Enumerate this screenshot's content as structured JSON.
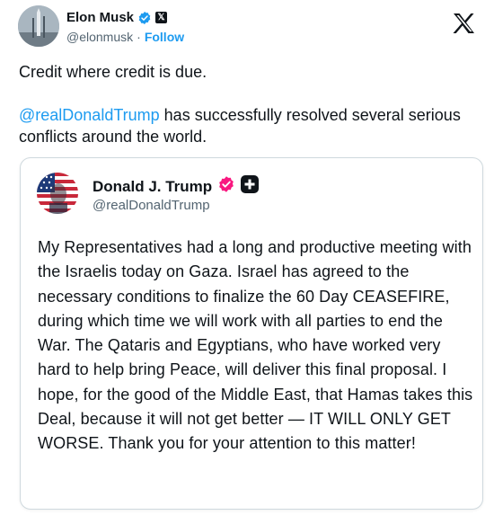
{
  "author": {
    "name": "Elon Musk",
    "handle": "@elonmusk",
    "separator": "·",
    "follow_label": "Follow",
    "verified_color": "#1d9bf0"
  },
  "platform_icon": "x-logo-icon",
  "tweet": {
    "line1": "Credit where credit is due.",
    "mention": "@realDonaldTrump",
    "line2_rest": " has successfully resolved several serious conflicts around the world."
  },
  "quoted": {
    "name": "Donald J. Trump",
    "handle": "@realDonaldTrump",
    "badge_color": "#f91880",
    "text": "My Representatives had a long and productive meeting with the Israelis today on Gaza. Israel has agreed to the necessary conditions to finalize the 60 Day CEASEFIRE, during which time we will work with all parties to end the War. The Qataris and Egyptians, who have worked very hard to help bring Peace, will deliver this final proposal. I hope, for the good of the Middle East, that Hamas takes this Deal, because it will not get better — IT WILL ONLY GET WORSE. Thank you for your attention to this matter!"
  }
}
